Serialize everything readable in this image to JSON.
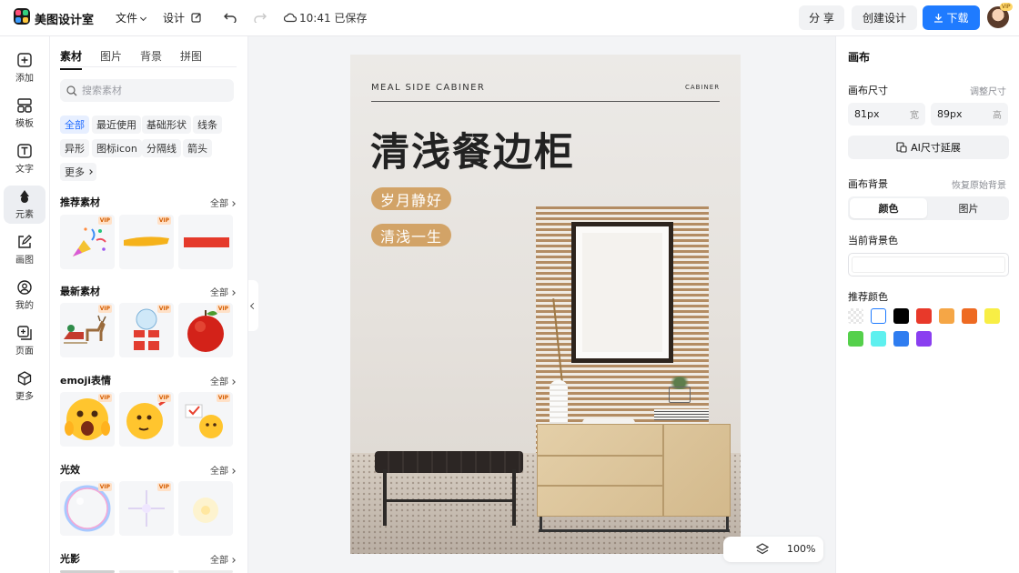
{
  "topbar": {
    "app_name": "美图设计室",
    "file_menu": "文件",
    "design_menu": "设计",
    "save_status": "10:41 已保存",
    "share_label": "分 享",
    "create_label": "创建设计",
    "download_label": "下载",
    "avatar_badge": "VIP"
  },
  "rail": [
    {
      "label": "添加",
      "icon": "plus-square-icon"
    },
    {
      "label": "模板",
      "icon": "template-icon"
    },
    {
      "label": "文字",
      "icon": "text-icon"
    },
    {
      "label": "元素",
      "icon": "shapes-icon"
    },
    {
      "label": "画图",
      "icon": "draw-icon"
    },
    {
      "label": "我的",
      "icon": "user-icon"
    },
    {
      "label": "页面",
      "icon": "page-add-icon"
    },
    {
      "label": "更多",
      "icon": "cube-icon"
    }
  ],
  "panel": {
    "tabs": [
      "素材",
      "图片",
      "背景",
      "拼图"
    ],
    "search_placeholder": "搜索素材",
    "chips": [
      "全部",
      "最近使用",
      "基础形状",
      "线条",
      "异形",
      "图标icon",
      "分隔线",
      "箭头",
      "更多"
    ],
    "all_label": "全部",
    "vip_label": "VIP",
    "sections": [
      "推荐素材",
      "最新素材",
      "emoji表情",
      "光效",
      "光影"
    ]
  },
  "poster": {
    "en_title": "MEAL SIDE CABINER",
    "brand": "CABINER",
    "title": "清浅餐边柜",
    "tag1": "岁月静好",
    "tag2": "清浅一生"
  },
  "zoom": "100%",
  "right": {
    "title": "画布",
    "size_label": "画布尺寸",
    "adjust_link": "调整尺寸",
    "width_value": "81px",
    "width_unit": "宽",
    "height_value": "89px",
    "height_unit": "高",
    "ai_button": "AI尺寸延展",
    "bg_label": "画布背景",
    "restore_link": "恢复原始背景",
    "seg_color": "颜色",
    "seg_image": "图片",
    "current_bg": "当前背景色",
    "recommend": "推荐颜色",
    "swatches": [
      "transparent",
      "#ffffff",
      "#000000",
      "#e8392a",
      "#f5a646",
      "#ee6a22",
      "#f8ee45",
      "#55d04b",
      "#5ef0ef",
      "#2f7df0",
      "#8a3ff0"
    ]
  }
}
